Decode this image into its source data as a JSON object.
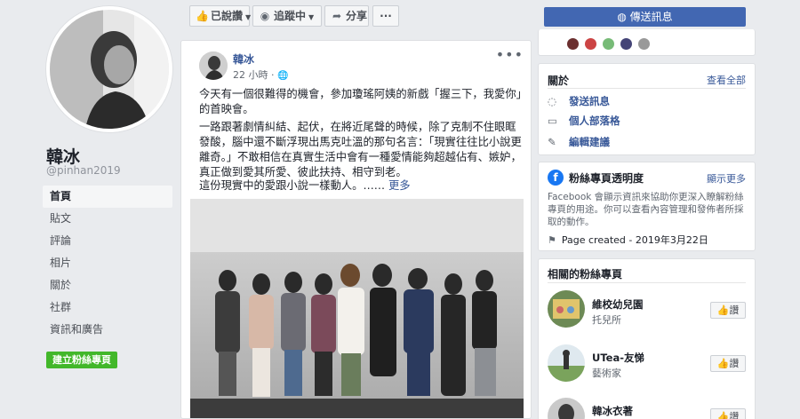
{
  "profile": {
    "name": "韓冰",
    "handle": "@pinhan2019"
  },
  "nav": {
    "items": [
      {
        "label": "首頁",
        "active": true
      },
      {
        "label": "貼文"
      },
      {
        "label": "評論"
      },
      {
        "label": "相片"
      },
      {
        "label": "關於"
      },
      {
        "label": "社群"
      },
      {
        "label": "資訊和廣告"
      }
    ],
    "create_page": "建立粉絲專頁"
  },
  "actions": {
    "liked": "已說讚",
    "following": "追蹤中",
    "share": "分享",
    "more": "···",
    "send_message": "傳送訊息"
  },
  "post": {
    "author": "韓冰",
    "time": "22 小時 · ",
    "paragraphs": [
      "今天有一個很難得的機會，參加瓊瑤阿姨的新戲「握三下，我愛你」的首映會。",
      "一路跟著劇情糾結、起伏，在將近尾聲的時候，除了克制不住眼眶發酸，腦中還不斷浮現出馬克吐溫的那句名言：「現實往往比小說更離奇。」不敢相信在真實生活中會有一種愛情能夠超越佔有、嫉妒，真正做到愛其所愛、彼此扶持、相守到老。",
      "這份現實中的愛跟小說一樣動人。……"
    ],
    "more_link": "更多"
  },
  "about": {
    "title": "關於",
    "see_all": "查看全部",
    "rows": [
      "發送訊息",
      "個人部落格",
      "編輯建議"
    ]
  },
  "transparency": {
    "title": "粉絲專頁透明度",
    "see_more": "顯示更多",
    "description": "Facebook 會顯示資訊來協助你更深入瞭解粉絲專頁的用途。你可以查看內容管理和發佈者所採取的動作。",
    "created": "Page created - 2019年3月22日"
  },
  "related": {
    "title": "相關的粉絲專頁",
    "like_label": "讚",
    "pages": [
      {
        "name": "維校幼兒園",
        "category": "托兒所"
      },
      {
        "name": "UTea-友悌",
        "category": "藝術家"
      },
      {
        "name": "韓冰衣著",
        "category": ""
      }
    ]
  },
  "colors": {
    "brand_blue": "#4267b2",
    "link": "#385898",
    "green": "#42b72a",
    "background": "#e9ebee"
  }
}
